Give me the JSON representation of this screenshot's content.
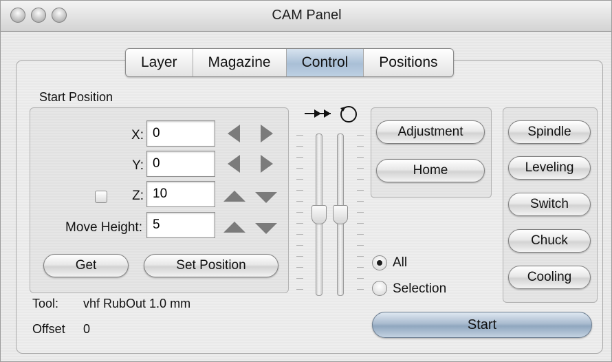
{
  "window": {
    "title": "CAM Panel"
  },
  "tabs": [
    {
      "label": "Layer",
      "active": false
    },
    {
      "label": "Magazine",
      "active": false
    },
    {
      "label": "Control",
      "active": true
    },
    {
      "label": "Positions",
      "active": false
    }
  ],
  "start_position": {
    "label": "Start Position",
    "x_label": "X:",
    "x_value": "0",
    "y_label": "Y:",
    "y_value": "0",
    "z_label": "Z:",
    "z_value": "10",
    "z_checked": false,
    "move_height_label": "Move Height:",
    "move_height_value": "5",
    "get_label": "Get",
    "set_position_label": "Set Position"
  },
  "tool": {
    "label": "Tool:",
    "value": "vhf RubOut 1.0 mm"
  },
  "offset": {
    "label": "Offset",
    "value": "0"
  },
  "sliders": {
    "feed_icon": "double-right-arrow-icon",
    "spindle_icon": "rotate-circle-icon",
    "feed_level": 0.5,
    "spindle_level": 0.5
  },
  "control_buttons": {
    "adjustment_label": "Adjustment",
    "home_label": "Home"
  },
  "right_buttons": [
    "Spindle",
    "Leveling",
    "Switch",
    "Chuck",
    "Cooling"
  ],
  "scope": {
    "options": [
      {
        "label": "All",
        "selected": true
      },
      {
        "label": "Selection",
        "selected": false
      }
    ]
  },
  "start_button": {
    "label": "Start"
  },
  "colors": {
    "accent": "#a9bfd6",
    "start_button": "#9fb3c8"
  }
}
